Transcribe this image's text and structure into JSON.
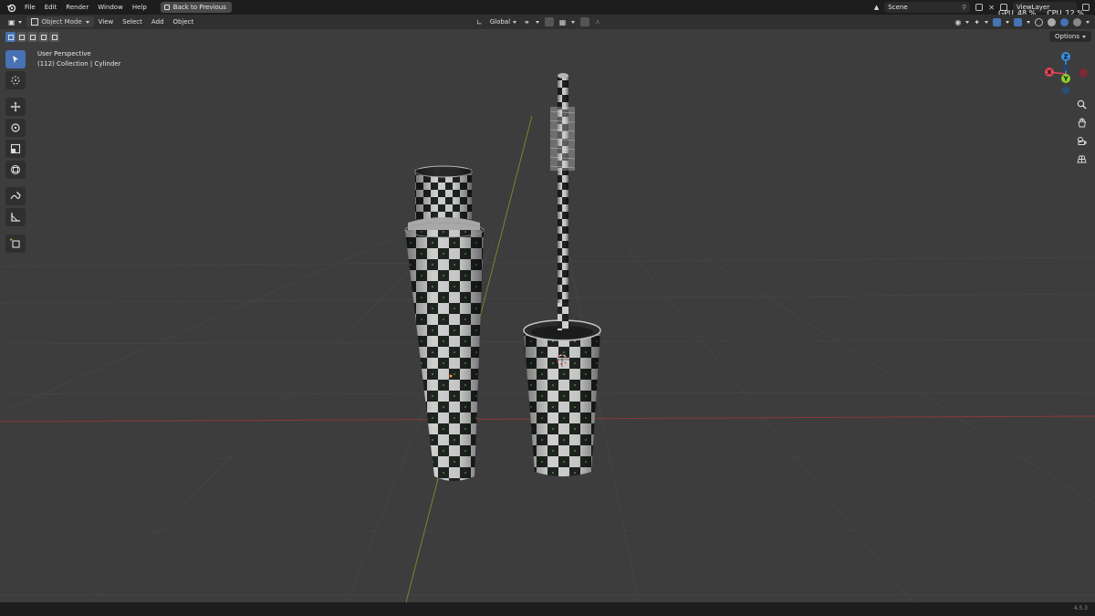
{
  "topbar": {
    "menu": [
      "File",
      "Edit",
      "Render",
      "Window",
      "Help"
    ],
    "back_label": "Back to Previous",
    "scene_label": "Scene",
    "viewlayer_label": "ViewLayer",
    "gpu_label": "GPU",
    "gpu_value": "48 %",
    "cpu_label": "CPU",
    "cpu_value": "12 %"
  },
  "header": {
    "mode_label": "Object Mode",
    "menu": [
      "View",
      "Select",
      "Add",
      "Object"
    ],
    "orientation_label": "Global"
  },
  "options_label": "Options",
  "viewport": {
    "perspective_label": "User Perspective",
    "collection_label": "(112) Collection | Cylinder"
  },
  "gizmo": {
    "z": "Z",
    "x": "X",
    "y": "Y"
  },
  "colors": {
    "accent": "#4772b3",
    "x_axis": "#e2465a",
    "y_axis": "#8bd12c",
    "z_axis": "#3a8fe0"
  },
  "icons": {
    "tools": [
      "select-box-icon",
      "cursor-icon",
      "move-icon",
      "rotate-icon",
      "scale-icon",
      "transform-icon",
      "annotate-icon",
      "measure-icon",
      "add-cube-icon"
    ],
    "nav": [
      "zoom-icon",
      "hand-pan-icon",
      "camera-icon",
      "grid-view-icon"
    ]
  },
  "status": {
    "version": "4.5.3"
  }
}
